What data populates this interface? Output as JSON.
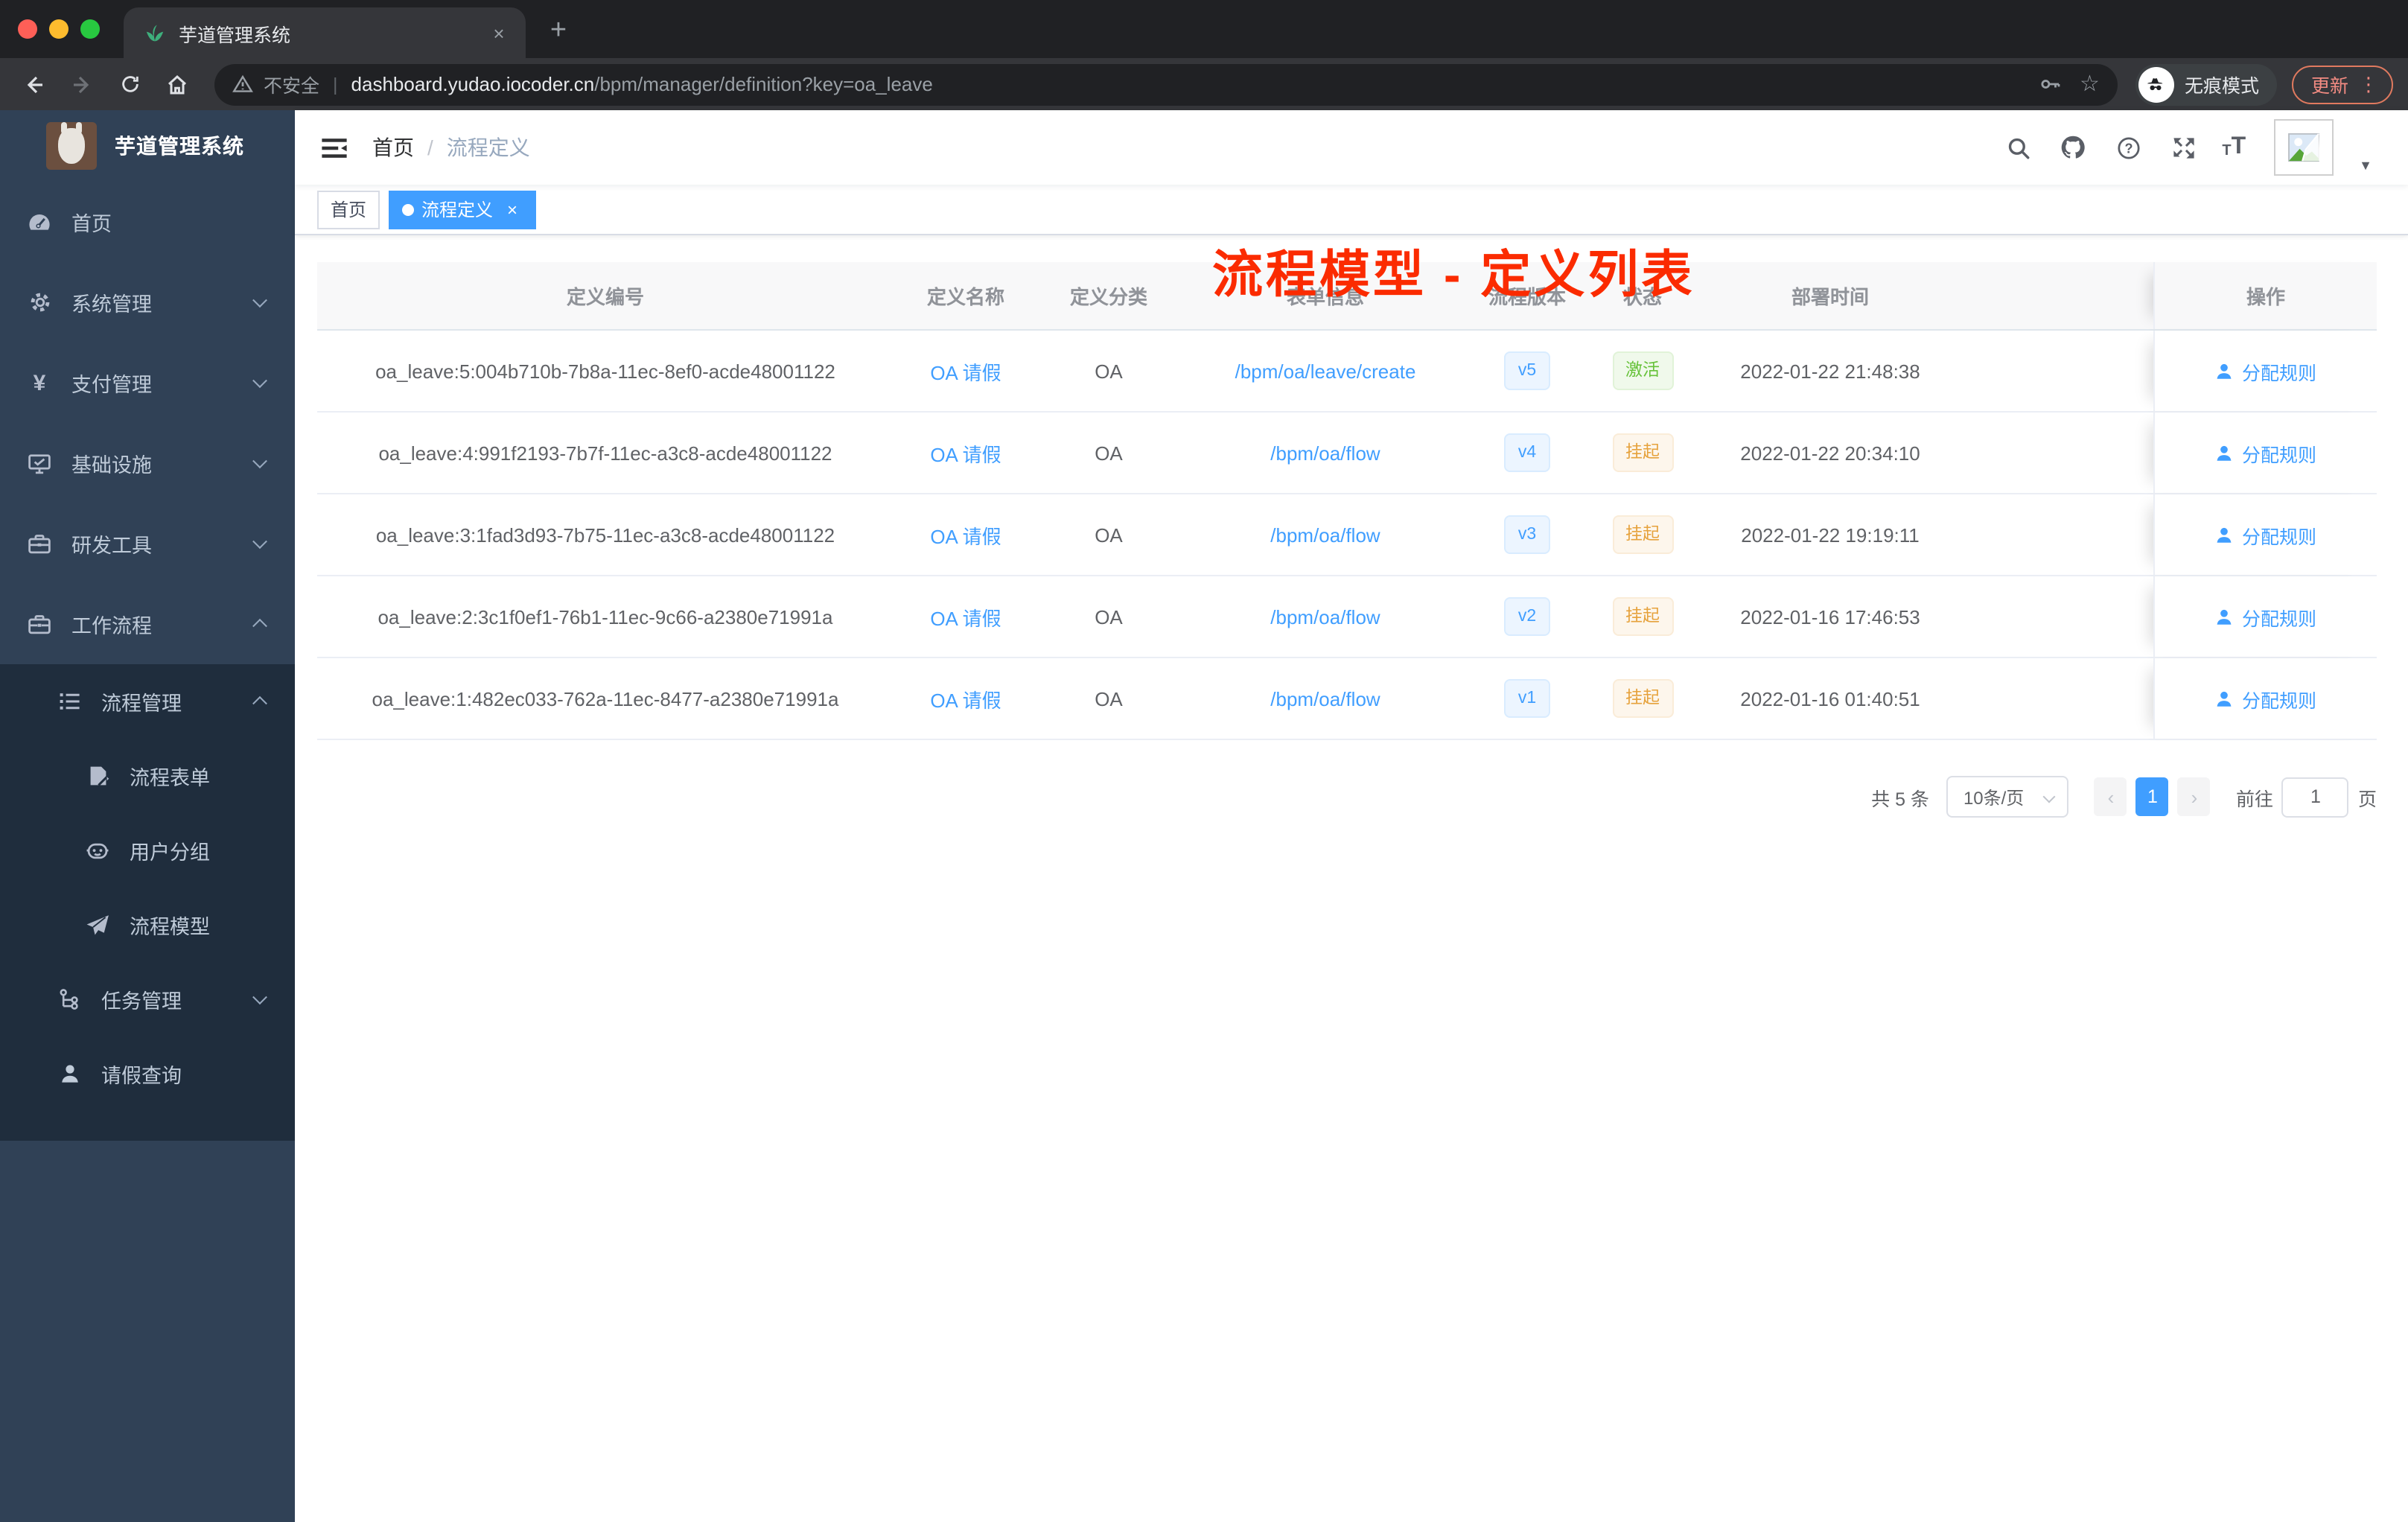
{
  "browser": {
    "tab_title": "芋道管理系统",
    "new_tab_button": "+",
    "tab_close": "×",
    "security_label": "不安全",
    "url_host": "dashboard.yudao.iocoder.cn",
    "url_path": "/bpm/manager/definition?key=oa_leave",
    "incognito_label": "无痕模式",
    "update_label": "更新",
    "kebab": "⋮"
  },
  "sidebar": {
    "app_title": "芋道管理系统",
    "items": [
      {
        "label": "首页"
      },
      {
        "label": "系统管理"
      },
      {
        "label": "支付管理"
      },
      {
        "label": "基础设施"
      },
      {
        "label": "研发工具"
      },
      {
        "label": "工作流程"
      },
      {
        "label": "流程管理"
      },
      {
        "label": "流程表单"
      },
      {
        "label": "用户分组"
      },
      {
        "label": "流程模型"
      },
      {
        "label": "任务管理"
      },
      {
        "label": "请假查询"
      }
    ]
  },
  "navbar": {
    "breadcrumb": {
      "home": "首页",
      "separator": "/",
      "current": "流程定义"
    }
  },
  "annotation": {
    "text": "流程模型 - 定义列表",
    "color": "#fb2b00"
  },
  "tags": {
    "home": "首页",
    "active": "流程定义",
    "close": "×"
  },
  "table": {
    "columns": [
      "定义编号",
      "定义名称",
      "定义分类",
      "表单信息",
      "流程版本",
      "状态",
      "部署时间",
      "操作"
    ],
    "rows": [
      {
        "id": "oa_leave:5:004b710b-7b8a-11ec-8ef0-acde48001122",
        "name": "OA 请假",
        "category": "OA",
        "form": "/bpm/oa/leave/create",
        "version": "v5",
        "status": "激活",
        "status_type": "success",
        "time": "2022-01-22 21:48:38",
        "action": "分配规则"
      },
      {
        "id": "oa_leave:4:991f2193-7b7f-11ec-a3c8-acde48001122",
        "name": "OA 请假",
        "category": "OA",
        "form": "/bpm/oa/flow",
        "version": "v4",
        "status": "挂起",
        "status_type": "warning",
        "time": "2022-01-22 20:34:10",
        "action": "分配规则"
      },
      {
        "id": "oa_leave:3:1fad3d93-7b75-11ec-a3c8-acde48001122",
        "name": "OA 请假",
        "category": "OA",
        "form": "/bpm/oa/flow",
        "version": "v3",
        "status": "挂起",
        "status_type": "warning",
        "time": "2022-01-22 19:19:11",
        "action": "分配规则"
      },
      {
        "id": "oa_leave:2:3c1f0ef1-76b1-11ec-9c66-a2380e71991a",
        "name": "OA 请假",
        "category": "OA",
        "form": "/bpm/oa/flow",
        "version": "v2",
        "status": "挂起",
        "status_type": "warning",
        "time": "2022-01-16 17:46:53",
        "action": "分配规则"
      },
      {
        "id": "oa_leave:1:482ec033-762a-11ec-8477-a2380e71991a",
        "name": "OA 请假",
        "category": "OA",
        "form": "/bpm/oa/flow",
        "version": "v1",
        "status": "挂起",
        "status_type": "warning",
        "time": "2022-01-16 01:40:51",
        "action": "分配规则"
      }
    ]
  },
  "pagination": {
    "total": "共 5 条",
    "page_size": "10条/页",
    "prev": "‹",
    "page": "1",
    "next": "›",
    "goto_label": "前往",
    "goto_value": "1",
    "page_unit": "页"
  },
  "colors": {
    "accent": "#409eff",
    "success": "#67c23a",
    "warning": "#e6a23c",
    "sidebar_bg": "#304156",
    "submenu_bg": "#1f2d3d",
    "annotation_red": "#fb2b00"
  },
  "icons": {
    "browser": [
      "plant-favicon",
      "close-icon",
      "plus-icon",
      "back-icon",
      "forward-icon",
      "reload-icon",
      "home-icon",
      "warning-icon",
      "key-icon",
      "star-icon",
      "incognito-icon",
      "kebab-menu-icon"
    ],
    "sidebar": [
      "dashboard-icon",
      "gear-icon",
      "yen-icon",
      "monitor-icon",
      "toolbox-icon",
      "briefcase-icon",
      "list-tree-icon",
      "form-icon",
      "robot-icon",
      "paper-plane-icon",
      "org-tree-icon",
      "user-icon"
    ],
    "navbar": [
      "hamburger-icon",
      "search-icon",
      "github-icon",
      "help-icon",
      "fullscreen-icon",
      "font-size-icon",
      "avatar-broken-image",
      "caret-down-icon"
    ],
    "table": [
      "user-icon"
    ]
  }
}
